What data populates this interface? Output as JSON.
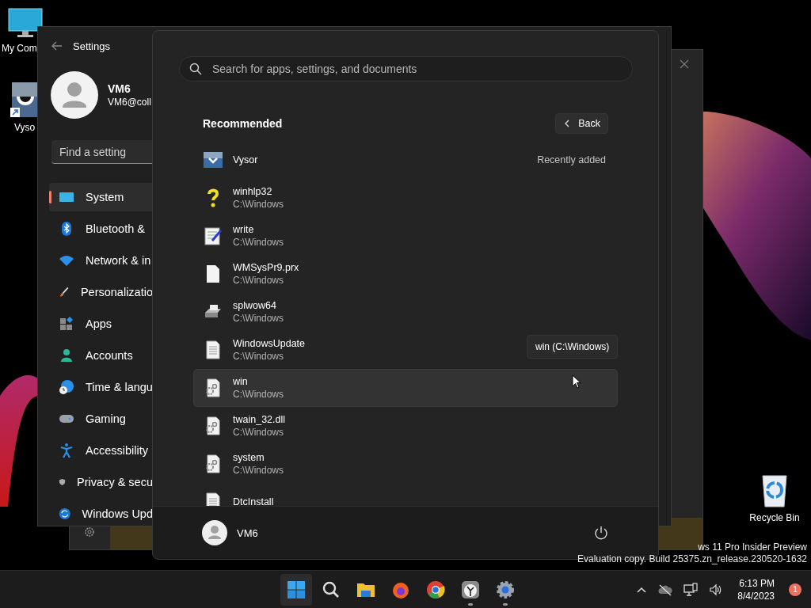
{
  "desktop": {
    "icons": [
      {
        "kind": "computer",
        "label": "My Com"
      },
      {
        "kind": "vysor",
        "label": "Vyso"
      },
      {
        "kind": "recycle-bin",
        "label": "Recycle Bin"
      }
    ],
    "watermark": [
      "ws 11 Pro Insider Preview",
      "Evaluation copy. Build 25375.zn_release.230520-1632"
    ]
  },
  "settings_window": {
    "title": "Settings",
    "user": {
      "name": "VM6",
      "email": "VM6@coll"
    },
    "search": {
      "placeholder": "Find a setting"
    },
    "nav": [
      {
        "kind": "system",
        "label": "System",
        "selected": true
      },
      {
        "kind": "bluetooth",
        "label": "Bluetooth &",
        "selected": false
      },
      {
        "kind": "network",
        "label": "Network & in",
        "selected": false
      },
      {
        "kind": "personalization",
        "label": "Personalizatio",
        "selected": false
      },
      {
        "kind": "apps",
        "label": "Apps",
        "selected": false
      },
      {
        "kind": "accounts",
        "label": "Accounts",
        "selected": false
      },
      {
        "kind": "time",
        "label": "Time & langu",
        "selected": false
      },
      {
        "kind": "gaming",
        "label": "Gaming",
        "selected": false
      },
      {
        "kind": "accessibility",
        "label": "Accessibility",
        "selected": false
      },
      {
        "kind": "privacy",
        "label": "Privacy & secu",
        "selected": false
      },
      {
        "kind": "update",
        "label": "Windows Upd",
        "selected": false
      }
    ]
  },
  "start_menu": {
    "search": {
      "placeholder": "Search for apps, settings, and documents"
    },
    "section_title": "Recommended",
    "back_button": "Back",
    "items": [
      {
        "kind": "app",
        "name": "Vysor",
        "note": "Recently added",
        "hovered": false
      },
      {
        "kind": "help",
        "name": "winhlp32",
        "path": "C:\\Windows",
        "hovered": false
      },
      {
        "kind": "notepad",
        "name": "write",
        "path": "C:\\Windows",
        "hovered": false
      },
      {
        "kind": "blank",
        "name": "WMSysPr9.prx",
        "path": "C:\\Windows",
        "hovered": false
      },
      {
        "kind": "printer",
        "name": "splwow64",
        "path": "C:\\Windows",
        "hovered": false
      },
      {
        "kind": "text",
        "name": "WindowsUpdate",
        "path": "C:\\Windows",
        "hovered": false
      },
      {
        "kind": "config",
        "name": "win",
        "path": "C:\\Windows",
        "hovered": true
      },
      {
        "kind": "config",
        "name": "twain_32.dll",
        "path": "C:\\Windows",
        "hovered": false
      },
      {
        "kind": "config",
        "name": "system",
        "path": "C:\\Windows",
        "hovered": false
      },
      {
        "kind": "text",
        "name": "DtcInstall",
        "hovered": false
      }
    ],
    "tooltip": "win (C:\\Windows)",
    "user": "VM6"
  },
  "taskbar": {
    "apps": [
      {
        "kind": "start",
        "selected": true,
        "running": false
      },
      {
        "kind": "search",
        "selected": false,
        "running": false
      },
      {
        "kind": "explorer",
        "selected": false,
        "running": false
      },
      {
        "kind": "firefox",
        "selected": false,
        "running": false
      },
      {
        "kind": "chrome",
        "selected": false,
        "running": false
      },
      {
        "kind": "clock",
        "selected": false,
        "running": true
      },
      {
        "kind": "settings",
        "selected": false,
        "running": true
      }
    ],
    "time": "6:13 PM",
    "date": "8/4/2023",
    "notification_count": "1"
  }
}
